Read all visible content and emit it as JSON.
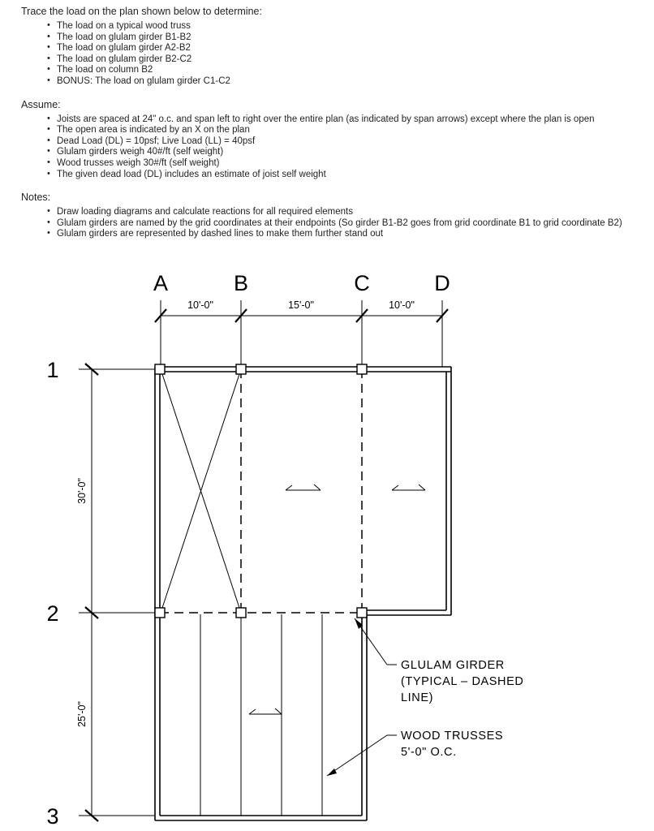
{
  "document": {
    "intro": "Trace the load on the plan shown below to determine:",
    "determine_items": [
      "The load on a typical wood truss",
      "The load on glulam girder B1-B2",
      "The load on glulam girder A2-B2",
      "The load on glulam girder B2-C2",
      "The load on column B2",
      "BONUS: The load on glulam girder C1-C2"
    ],
    "assume_heading": "Assume:",
    "assume_items": [
      "Joists are spaced at 24\" o.c. and span left to right over the entire plan (as indicated by span arrows) except where the plan is open",
      "The open area is indicated by an X on the plan",
      "Dead Load (DL) = 10psf; Live Load (LL) = 40psf",
      "Glulam girders weigh 40#/ft (self weight)",
      "Wood trusses weigh 30#/ft (self weight)",
      "The given dead load (DL) includes an estimate of joist self weight"
    ],
    "notes_heading": "Notes:",
    "notes_items": [
      "Draw loading diagrams and calculate reactions for all required elements",
      "Glulam girders are named by the grid coordinates at their endpoints (So girder B1-B2 goes from grid coordinate B1 to grid coordinate B2)",
      "Glulam girders are represented by dashed lines to make them further stand out"
    ]
  },
  "plan": {
    "column_grid_labels": [
      "A",
      "B",
      "C",
      "D"
    ],
    "row_grid_labels": [
      "1",
      "2",
      "3"
    ],
    "horizontal_dimensions": [
      "10'-0\"",
      "15'-0\"",
      "10'-0\""
    ],
    "vertical_dimensions": [
      "30'-0\"",
      "25'-0\""
    ],
    "annotations": {
      "girder_line1": "GLULAM  GIRDER",
      "girder_line2": "(TYPICAL  –  DASHED",
      "girder_line3": "LINE)",
      "truss_line1": "WOOD  TRUSSES",
      "truss_line2": "5'-0\"  O.C."
    },
    "colors": {
      "line": "#000000",
      "background": "#ffffff",
      "text": "#231f20"
    }
  }
}
